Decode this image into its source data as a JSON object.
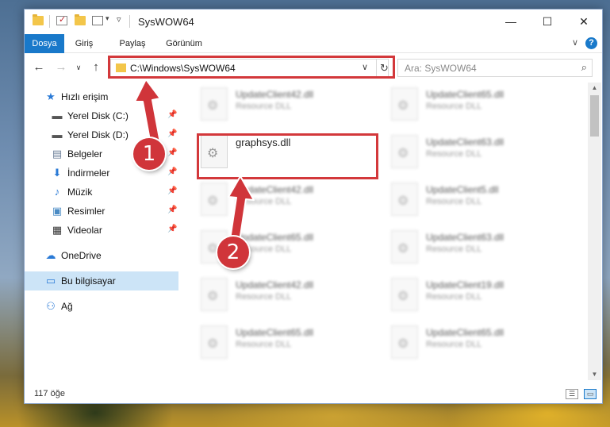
{
  "window": {
    "title": "SysWOW64",
    "controls": {
      "minimize": "—",
      "maximize": "☐",
      "close": "✕"
    }
  },
  "ribbon": {
    "tabs": [
      {
        "label": "Dosya",
        "active": true
      },
      {
        "label": "Giriş",
        "active": false
      },
      {
        "label": "Paylaş",
        "active": false
      },
      {
        "label": "Görünüm",
        "active": false
      }
    ],
    "help": "?"
  },
  "navigation": {
    "address": "C:\\Windows\\SysWOW64",
    "search_placeholder": "Ara: SysWOW64"
  },
  "sidebar": {
    "items": [
      {
        "label": "Hızlı erişim",
        "icon": "star-icon",
        "pinned": false
      },
      {
        "label": "Yerel Disk (C:)",
        "icon": "drive-icon",
        "pinned": true
      },
      {
        "label": "Yerel Disk (D:)",
        "icon": "drive-icon",
        "pinned": true
      },
      {
        "label": "Belgeler",
        "icon": "document-icon",
        "pinned": true
      },
      {
        "label": "İndirmeler",
        "icon": "download-icon",
        "pinned": true
      },
      {
        "label": "Müzik",
        "icon": "music-icon",
        "pinned": true
      },
      {
        "label": "Resimler",
        "icon": "picture-icon",
        "pinned": true
      },
      {
        "label": "Videolar",
        "icon": "video-icon",
        "pinned": true
      },
      {
        "label": "OneDrive",
        "icon": "cloud-icon",
        "pinned": false
      },
      {
        "label": "Bu bilgisayar",
        "icon": "computer-icon",
        "pinned": false,
        "selected": true
      },
      {
        "label": "Ağ",
        "icon": "network-icon",
        "pinned": false
      }
    ]
  },
  "files": {
    "left_column": [
      {
        "name": "UpdateClient42.dll",
        "type": "Resource DLL"
      },
      {
        "name": "graphsys.dll",
        "type": "",
        "highlighted": true
      },
      {
        "name": "UpdateClient42.dll",
        "type": "Resource DLL"
      },
      {
        "name": "UpdateClient65.dll",
        "type": "Resource DLL"
      },
      {
        "name": "UpdateClient42.dll",
        "type": "Resource DLL"
      },
      {
        "name": "UpdateClient65.dll",
        "type": "Resource DLL"
      }
    ],
    "right_column": [
      {
        "name": "UpdateClient65.dll",
        "type": "Resource DLL"
      },
      {
        "name": "UpdateClient63.dll",
        "type": "Resource DLL"
      },
      {
        "name": "UpdateClient5.dll",
        "type": "Resource DLL"
      },
      {
        "name": "UpdateClient63.dll",
        "type": "Resource DLL"
      },
      {
        "name": "UpdateClient19.dll",
        "type": "Resource DLL"
      },
      {
        "name": "UpdateClient65.dll",
        "type": "Resource DLL"
      }
    ]
  },
  "status": {
    "item_count": "117 öğe"
  },
  "annotations": {
    "step1": "1",
    "step2": "2",
    "color": "#d0353a"
  }
}
